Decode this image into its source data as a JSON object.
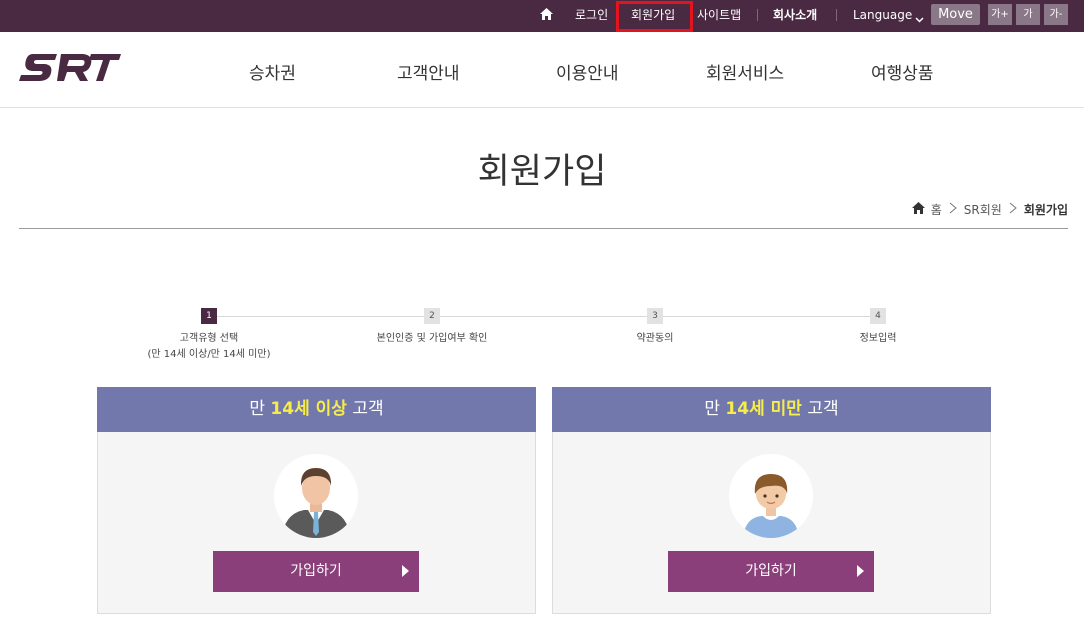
{
  "topbar": {
    "login": "로그인",
    "join": "회원가입",
    "sitemap": "사이트맵",
    "company": "회사소개",
    "language": "Language",
    "move": "Move",
    "font_up": "가+",
    "font_mid": "가",
    "font_down": "가-"
  },
  "header": {
    "logo_text": "SRT",
    "nav": [
      "승차권",
      "고객안내",
      "이용안내",
      "회원서비스",
      "여행상품"
    ]
  },
  "page": {
    "title": "회원가입",
    "breadcrumb": [
      "홈",
      "SR회원",
      "회원가입"
    ]
  },
  "steps": [
    {
      "num": "1",
      "label_1": "고객유형 선택",
      "label_2": "(만 14세 이상/만 14세 미만)",
      "active": true
    },
    {
      "num": "2",
      "label_1": "본인인증 및 가입여부 확인",
      "label_2": "",
      "active": false
    },
    {
      "num": "3",
      "label_1": "약관동의",
      "label_2": "",
      "active": false
    },
    {
      "num": "4",
      "label_1": "정보입력",
      "label_2": "",
      "active": false
    }
  ],
  "cards": [
    {
      "prefix": "만 ",
      "highlight": "14세 이상",
      "suffix": " 고객",
      "button": "가입하기"
    },
    {
      "prefix": "만 ",
      "highlight": "14세 미만",
      "suffix": " 고객",
      "button": "가입하기"
    }
  ],
  "colors": {
    "topbar_bg": "#4a2a42",
    "card_head": "#7378ac",
    "highlight": "#f6ec4a",
    "button": "#8b3f7a",
    "join_outline": "#e3141e"
  }
}
